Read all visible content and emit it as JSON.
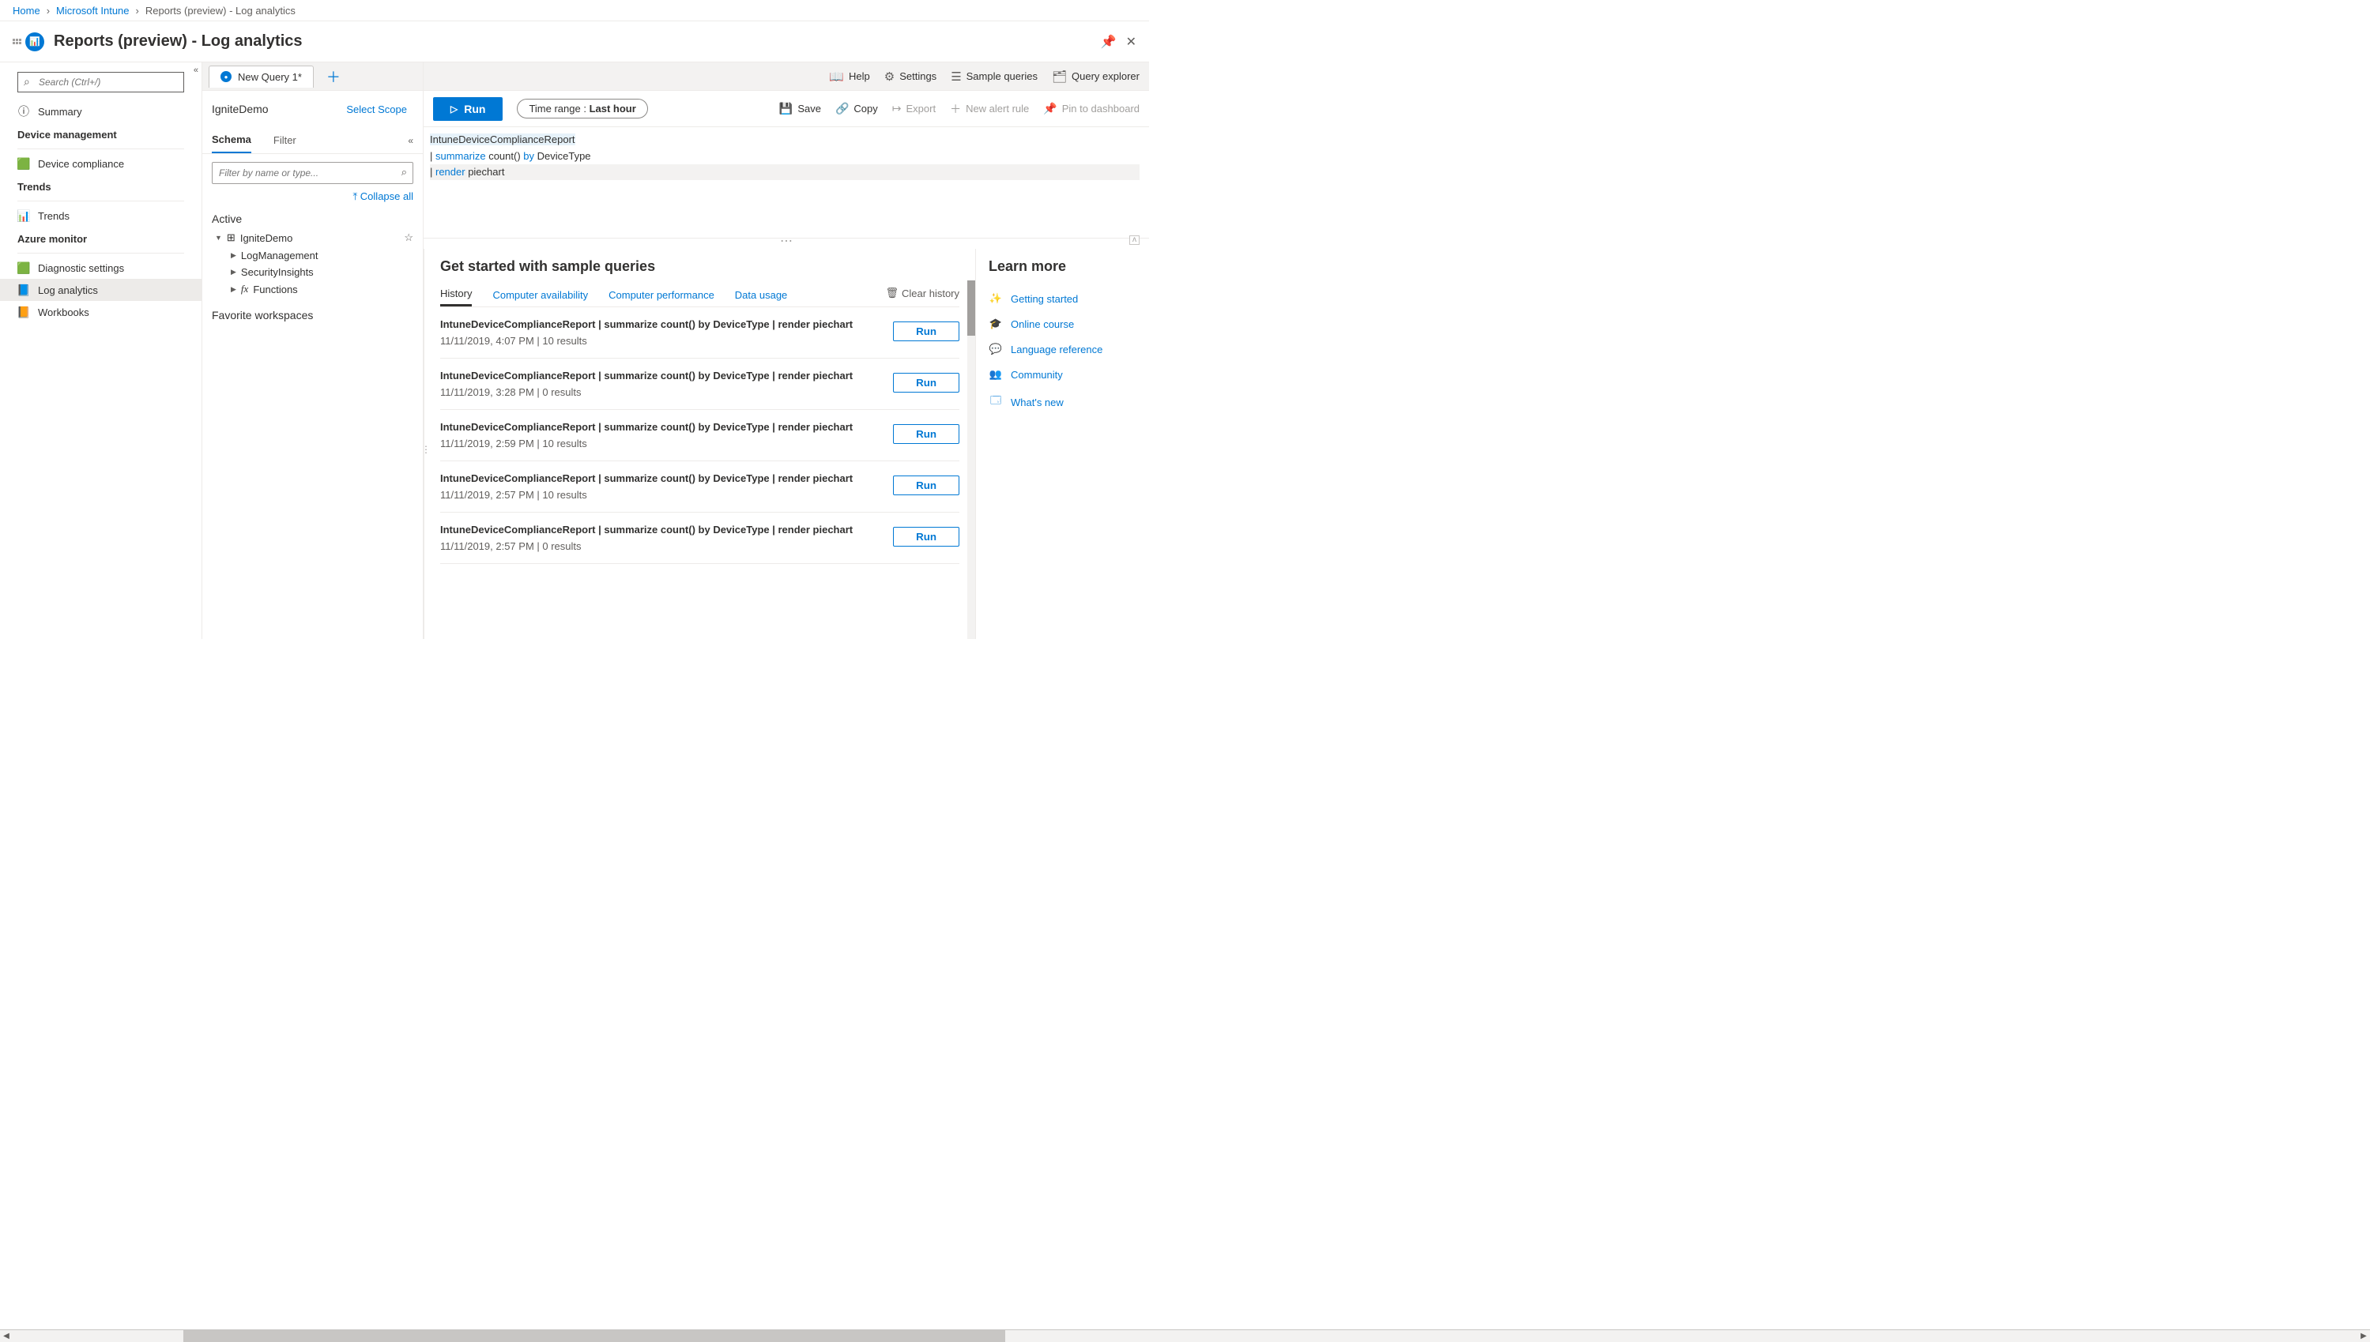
{
  "breadcrumb": [
    "Home",
    "Microsoft Intune",
    "Reports (preview) - Log analytics"
  ],
  "page_title": "Reports (preview) - Log analytics",
  "leftnav": {
    "search_placeholder": "Search (Ctrl+/)",
    "groups": [
      {
        "header": null,
        "items": [
          {
            "icon": "ⓘ",
            "label": "Summary"
          }
        ]
      },
      {
        "header": "Device management",
        "items": [
          {
            "icon": "🟩",
            "label": "Device compliance"
          }
        ]
      },
      {
        "header": "Trends",
        "items": [
          {
            "icon": "📊",
            "label": "Trends"
          }
        ]
      },
      {
        "header": "Azure monitor",
        "items": [
          {
            "icon": "🟩",
            "label": "Diagnostic settings"
          },
          {
            "icon": "📘",
            "label": "Log analytics",
            "selected": true
          },
          {
            "icon": "📙",
            "label": "Workbooks"
          }
        ]
      }
    ]
  },
  "query_tabs": {
    "tabs": [
      {
        "label": "New Query 1*"
      }
    ]
  },
  "app_toolbar": {
    "help": "Help",
    "settings": "Settings",
    "samples": "Sample queries",
    "explorer": "Query explorer"
  },
  "scope": {
    "workspace": "IgniteDemo",
    "select_scope": "Select Scope"
  },
  "run_button": "Run",
  "time_range": {
    "label": "Time range : ",
    "value": "Last hour"
  },
  "actions": {
    "save": "Save",
    "copy": "Copy",
    "export": "Export",
    "new_alert": "New alert rule",
    "pin": "Pin to dashboard"
  },
  "schema_tabs": {
    "schema": "Schema",
    "filter": "Filter"
  },
  "schema": {
    "filter_placeholder": "Filter by name or type...",
    "collapse_all": "Collapse all",
    "section_active": "Active",
    "workspace": "IgniteDemo",
    "children": [
      "LogManagement",
      "SecurityInsights",
      "Functions"
    ],
    "favorites_section": "Favorite workspaces"
  },
  "editor": {
    "line1": "IntuneDeviceComplianceReport",
    "line2_pipe": "| ",
    "line2_kw": "summarize",
    "line2_mid": " count() ",
    "line2_by": "by",
    "line2_col": " DeviceType",
    "line3_pipe": "| ",
    "line3_kw": "render",
    "line3_rest": " piechart"
  },
  "results": {
    "heading": "Get started with sample queries",
    "tabs": [
      "History",
      "Computer availability",
      "Computer performance",
      "Data usage"
    ],
    "clear": "Clear history",
    "run_label": "Run",
    "history": [
      {
        "query": "IntuneDeviceComplianceReport | summarize count() by DeviceType | render piechart",
        "meta": "11/11/2019, 4:07 PM | 10 results"
      },
      {
        "query": "IntuneDeviceComplianceReport | summarize count() by DeviceType | render piechart",
        "meta": "11/11/2019, 3:28 PM | 0 results"
      },
      {
        "query": "IntuneDeviceComplianceReport | summarize count() by DeviceType | render piechart",
        "meta": "11/11/2019, 2:59 PM | 10 results"
      },
      {
        "query": "IntuneDeviceComplianceReport | summarize count() by DeviceType | render piechart",
        "meta": "11/11/2019, 2:57 PM | 10 results"
      },
      {
        "query": "IntuneDeviceComplianceReport | summarize count() by DeviceType | render piechart",
        "meta": "11/11/2019, 2:57 PM | 0 results"
      }
    ]
  },
  "learn": {
    "heading": "Learn more",
    "links": [
      {
        "icon": "✨",
        "label": "Getting started"
      },
      {
        "icon": "🎓",
        "label": "Online course"
      },
      {
        "icon": "💬",
        "label": "Language reference"
      },
      {
        "icon": "👥",
        "label": "Community"
      },
      {
        "icon": "🗔",
        "label": "What's new"
      }
    ]
  }
}
